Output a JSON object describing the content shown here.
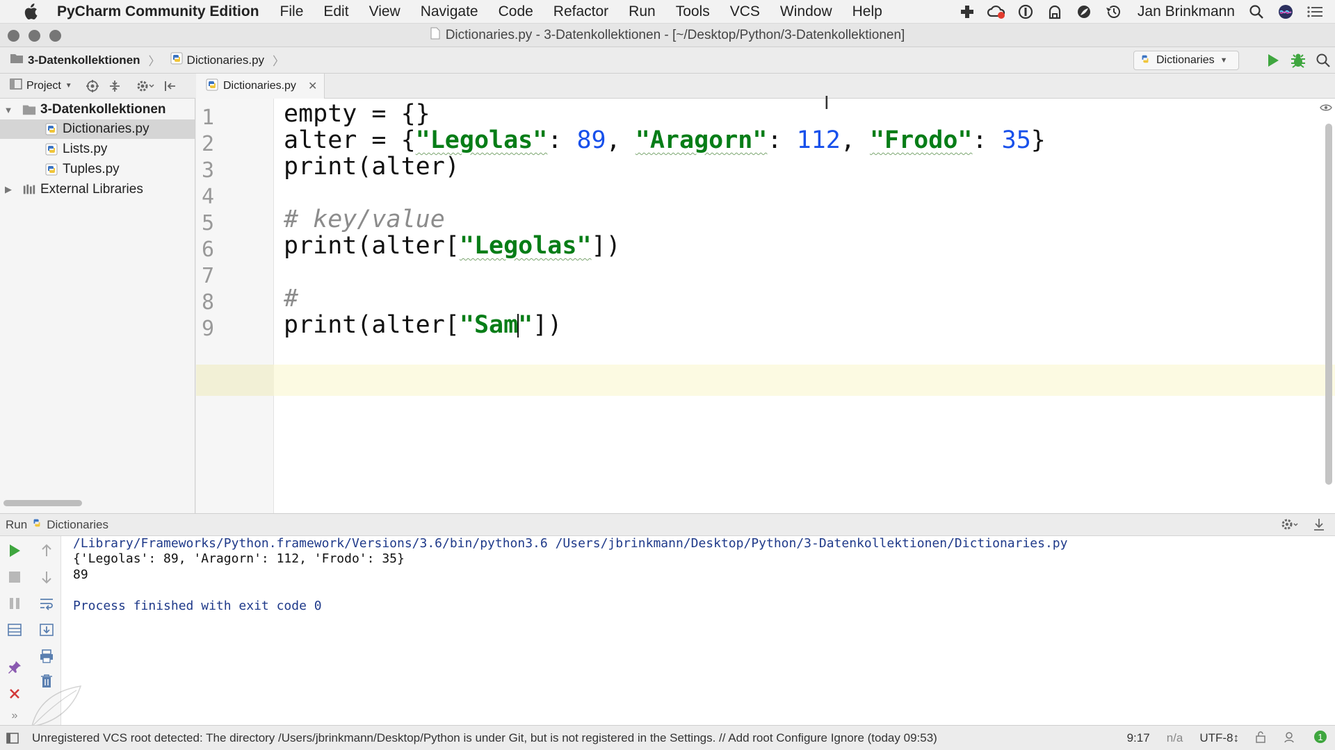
{
  "menubar": {
    "app_name": "PyCharm Community Edition",
    "items": [
      "File",
      "Edit",
      "View",
      "Navigate",
      "Code",
      "Refactor",
      "Run",
      "Tools",
      "VCS",
      "Window",
      "Help"
    ],
    "user": "Jan Brinkmann"
  },
  "window": {
    "title": "Dictionaries.py - 3-Datenkollektionen - [~/Desktop/Python/3-Datenkollektionen]"
  },
  "navbar": {
    "breadcrumbs": [
      "3-Datenkollektionen",
      "Dictionaries.py"
    ],
    "run_config": "Dictionaries"
  },
  "project_panel": {
    "label": "Project",
    "root": "3-Datenkollektionen",
    "files": [
      "Dictionaries.py",
      "Lists.py",
      "Tuples.py"
    ],
    "selected_file": "Dictionaries.py",
    "external": "External Libraries"
  },
  "editor": {
    "tab": "Dictionaries.py",
    "line_numbers": [
      "1",
      "2",
      "3",
      "4",
      "5",
      "6",
      "7",
      "8",
      "9"
    ],
    "current_line": 9,
    "lines": [
      [
        {
          "t": "empty = {}",
          "c": ""
        }
      ],
      [
        {
          "t": "alter = {",
          "c": ""
        },
        {
          "t": "\"Legolas\"",
          "c": "str sq"
        },
        {
          "t": ": ",
          "c": ""
        },
        {
          "t": "89",
          "c": "num"
        },
        {
          "t": ", ",
          "c": ""
        },
        {
          "t": "\"Aragorn\"",
          "c": "str sq"
        },
        {
          "t": ": ",
          "c": ""
        },
        {
          "t": "112",
          "c": "num"
        },
        {
          "t": ", ",
          "c": ""
        },
        {
          "t": "\"Frodo\"",
          "c": "str sq"
        },
        {
          "t": ": ",
          "c": ""
        },
        {
          "t": "35",
          "c": "num"
        },
        {
          "t": "}",
          "c": ""
        }
      ],
      [
        {
          "t": "print(alter)",
          "c": ""
        }
      ],
      [],
      [
        {
          "t": "# key/value",
          "c": "cmt"
        }
      ],
      [
        {
          "t": "print(alter[",
          "c": ""
        },
        {
          "t": "\"Legolas\"",
          "c": "str sq"
        },
        {
          "t": "])",
          "c": ""
        }
      ],
      [],
      [
        {
          "t": "#",
          "c": "cmt"
        }
      ],
      [
        {
          "t": "print(alter[",
          "c": ""
        },
        {
          "t": "\"Sam",
          "c": "str"
        },
        {
          "t": "|",
          "c": "caret"
        },
        {
          "t": "\"",
          "c": "str"
        },
        {
          "t": "])",
          "c": ""
        }
      ]
    ]
  },
  "run_panel": {
    "label": "Run",
    "config": "Dictionaries",
    "output": [
      {
        "text": "/Library/Frameworks/Python.framework/Versions/3.6/bin/python3.6 /Users/jbrinkmann/Desktop/Python/3-Datenkollektionen/Dictionaries.py",
        "kind": "path"
      },
      {
        "text": "{'Legolas': 89, 'Aragorn': 112, 'Frodo': 35}",
        "kind": "out"
      },
      {
        "text": "89",
        "kind": "out"
      },
      {
        "text": "",
        "kind": "out"
      },
      {
        "text": "Process finished with exit code 0",
        "kind": "exit"
      }
    ]
  },
  "statusbar": {
    "message": "Unregistered VCS root detected: The directory /Users/jbrinkmann/Desktop/Python is under Git, but is not registered in the Settings. // Add root  Configure  Ignore (today 09:53)",
    "position": "9:17",
    "separator": "n/a",
    "encoding": "UTF-8↕"
  },
  "colors": {
    "string": "#067d17",
    "number": "#1750eb",
    "comment": "#8c8c8c",
    "run_green": "#3fa63f",
    "stop_red": "#d33b3b"
  }
}
